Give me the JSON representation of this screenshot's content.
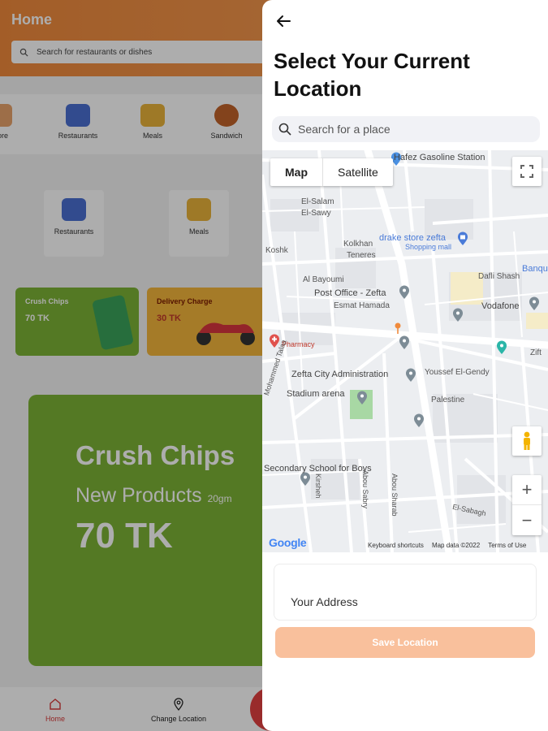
{
  "background": {
    "header_title": "Home",
    "search_placeholder": "Search for restaurants or dishes",
    "categories": [
      {
        "label": "store"
      },
      {
        "label": "Restaurants"
      },
      {
        "label": "Meals"
      },
      {
        "label": "Sandwich"
      }
    ],
    "category_cards": [
      {
        "label": "Restaurants"
      },
      {
        "label": "Meals"
      }
    ],
    "promo_cards": [
      {
        "title": "Crush Chips",
        "price": "70 TK"
      },
      {
        "title": "Delivery Charge",
        "price": "30 TK"
      }
    ],
    "banner": {
      "title": "Crush Chips",
      "subtitle": "New Products",
      "weight": "20gm",
      "price": "70 TK"
    },
    "bottom_nav": [
      {
        "label": "Home"
      },
      {
        "label": "Change Location"
      }
    ],
    "colors": {
      "brand_orange": "#f08a3c",
      "promo_green": "#7cb336",
      "promo_yellow": "#f3b53c"
    }
  },
  "sheet": {
    "title": "Select Your Current Location",
    "search_placeholder": "Search for a place",
    "map": {
      "map_btn": "Map",
      "satellite_btn": "Satellite",
      "zoom_in": "+",
      "zoom_out": "−",
      "labels": [
        "Hafez Gasoline Station",
        "El-Salam",
        "El-Sawy",
        "Kolkhan",
        "Teneres",
        "Koshk",
        "drake store zefta",
        "Shopping mall",
        "Al Bayoumi",
        "Post Office - Zefta",
        "Esmat Hamada",
        "Dafli Shash",
        "Vodafone",
        "Pharmacy",
        "Zefta City Administration",
        "Youssef El-Gendy",
        "Stadium arena",
        "Palestine",
        "Mohammed Talaa",
        "Secondary School for Boys",
        "Abou Sabry",
        "Abou Sharab",
        "Kirsheh",
        "El-Sabagh",
        "Banque",
        "Zift"
      ],
      "google": "Google",
      "footer": [
        "Keyboard shortcuts",
        "Map data ©2022",
        "Terms of Use"
      ]
    },
    "address_placeholder": "Your Address",
    "save_label": "Save Location",
    "colors": {
      "save_button": "#f9c09c",
      "search_bg": "#f1f2f6"
    }
  }
}
